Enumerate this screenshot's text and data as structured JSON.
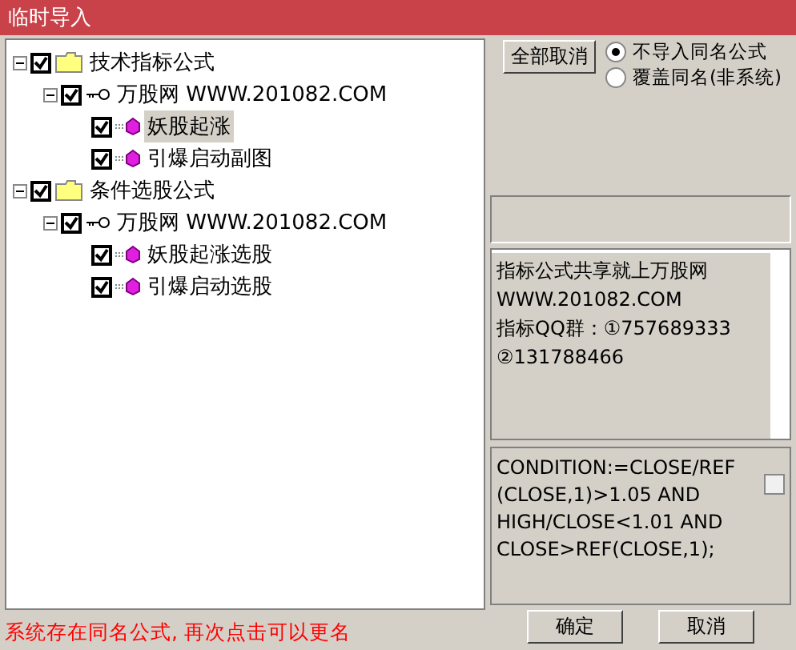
{
  "window": {
    "title": "临时导入"
  },
  "tree": [
    {
      "kind": "folder",
      "label": "技术指标公式",
      "checked": true,
      "expanded": true,
      "selected": false,
      "children": [
        {
          "kind": "source",
          "label": "万股网 WWW.201082.COM",
          "checked": true,
          "expanded": true,
          "selected": false,
          "children": [
            {
              "kind": "formula",
              "label": "妖股起涨",
              "checked": true,
              "selected": true
            },
            {
              "kind": "formula",
              "label": "引爆启动副图",
              "checked": true,
              "selected": false
            }
          ]
        }
      ]
    },
    {
      "kind": "folder",
      "label": "条件选股公式",
      "checked": true,
      "expanded": true,
      "selected": false,
      "children": [
        {
          "kind": "source",
          "label": "万股网 WWW.201082.COM",
          "checked": true,
          "expanded": true,
          "selected": false,
          "children": [
            {
              "kind": "formula",
              "label": "妖股起涨选股",
              "checked": true,
              "selected": false
            },
            {
              "kind": "formula",
              "label": "引爆启动选股",
              "checked": true,
              "selected": false
            }
          ]
        }
      ]
    }
  ],
  "cancel_all_button": "全部取消",
  "options": [
    {
      "label": "不导入同名公式",
      "selected": true
    },
    {
      "label": "覆盖同名(非系统)",
      "selected": false
    }
  ],
  "info_lines": [
    "指标公式共享就上万股网",
    "WWW.201082.COM",
    "指标QQ群：①757689333",
    "②131788466"
  ],
  "formula_lines": [
    "CONDITION:=CLOSE/REF",
    "(CLOSE,1)>1.05 AND",
    "HIGH/CLOSE<1.01 AND",
    "CLOSE>REF(CLOSE,1);"
  ],
  "formula_checkbox": {
    "checked": false
  },
  "status": "系统存在同名公式, 再次点击可以更名",
  "buttons": [
    "确定",
    "取消"
  ]
}
